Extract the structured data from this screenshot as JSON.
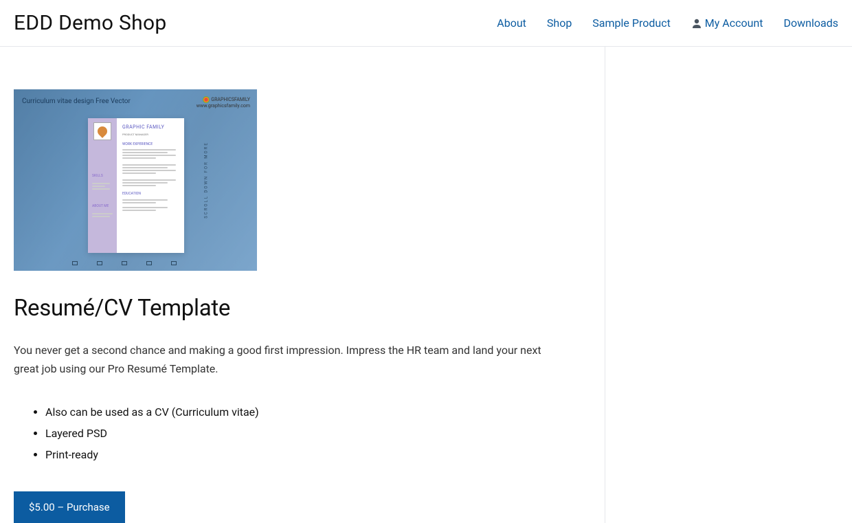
{
  "site": {
    "title": "EDD Demo Shop"
  },
  "nav": {
    "about": "About",
    "shop": "Shop",
    "sample": "Sample Product",
    "account": "My Account",
    "downloads": "Downloads"
  },
  "product": {
    "title": "Resumé/CV Template",
    "description": "You never get a second chance and making a good first impression. Impress the HR team and land your next great job using our Pro Resumé Template.",
    "features": [
      "Also can be used as a CV (Curriculum vitae)",
      "Layered PSD",
      "Print-ready"
    ],
    "purchase_label": "$5.00 – Purchase"
  },
  "preview": {
    "label": "Curriculum vitae design Free Vector",
    "badge_name": "GRAPHICSFAMILY",
    "badge_url": "www.graphicsfamily.com",
    "side_text": "SCROLL DOWN FOR MORE",
    "doc_name": "GRAPHIC FAMILY",
    "doc_role": "PRODUCT MANAGER",
    "section_experience": "WORK EXPERIENCE",
    "section_education": "EDUCATION",
    "left_skills": "SKILLS",
    "left_about": "ABOUT ME"
  }
}
